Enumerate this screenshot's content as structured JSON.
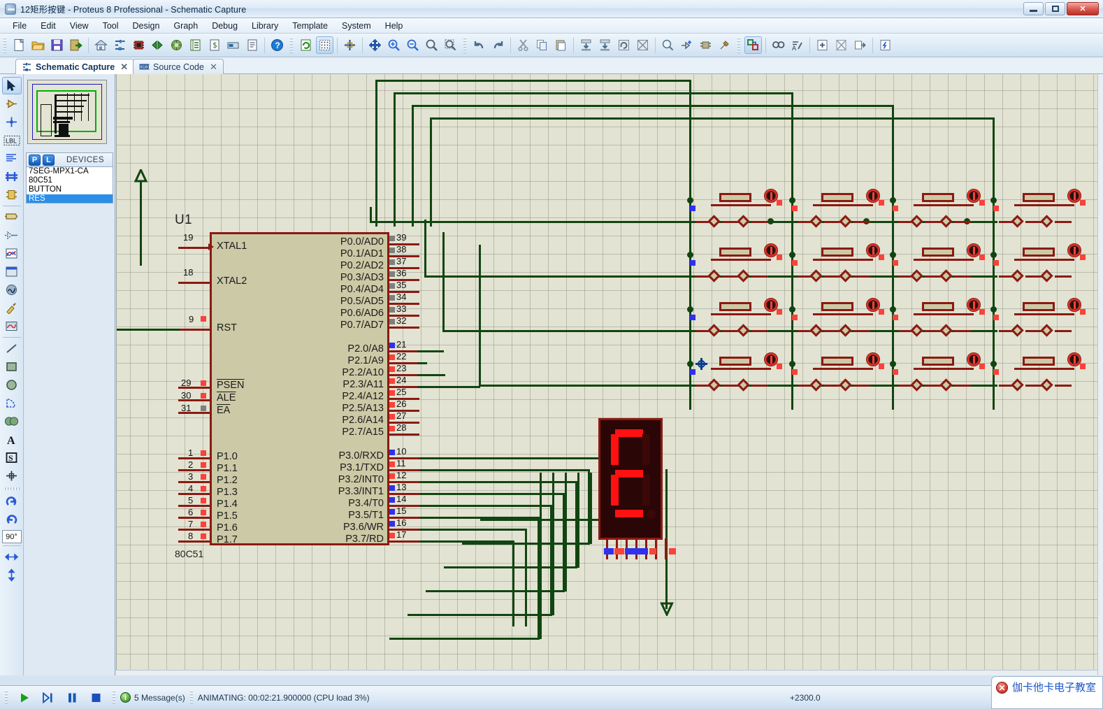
{
  "window": {
    "title": "12矩形按键 - Proteus 8 Professional - Schematic Capture",
    "app_icon": "proteus-app-icon",
    "minimize": "–",
    "maximize": "□",
    "close": "✕"
  },
  "menu": {
    "items": [
      "File",
      "Edit",
      "View",
      "Tool",
      "Design",
      "Graph",
      "Debug",
      "Library",
      "Template",
      "System",
      "Help"
    ]
  },
  "toolbar": {
    "groups": [
      {
        "name": "file-group",
        "buttons": [
          {
            "icon": "new-document-icon",
            "label": "New Project"
          },
          {
            "icon": "open-folder-icon",
            "label": "Open Project"
          },
          {
            "icon": "save-floppy-icon",
            "label": "Save Project"
          },
          {
            "icon": "import-export-icon",
            "label": "Import/Export"
          },
          {
            "icon": "home-icon",
            "label": "Home Page"
          },
          {
            "icon": "schematic-capture-icon",
            "label": "Schematic Capture"
          },
          {
            "icon": "pcb-layout-icon",
            "label": "PCB Layout"
          },
          {
            "icon": "3d-visualizer-icon",
            "label": "3D Visualizer"
          },
          {
            "icon": "simulation-icon",
            "label": "Simulation"
          },
          {
            "icon": "bill-of-materials-icon",
            "label": "Bill of Materials"
          },
          {
            "icon": "design-explorer-icon",
            "label": "Design Explorer"
          },
          {
            "icon": "report-icon",
            "label": "Reports"
          },
          {
            "icon": "notes-icon",
            "label": "Notes"
          },
          {
            "icon": "help-icon",
            "label": "Help"
          }
        ]
      },
      {
        "name": "view-group",
        "buttons": [
          {
            "icon": "refresh-icon",
            "label": "Redraw Display"
          },
          {
            "icon": "grid-toggle-icon",
            "label": "Toggle Grid",
            "active": true
          },
          {
            "icon": "origin-icon",
            "label": "Toggle Origin"
          },
          {
            "icon": "pan-icon",
            "label": "Pan"
          },
          {
            "icon": "zoom-in-icon",
            "label": "Zoom In"
          },
          {
            "icon": "zoom-out-icon",
            "label": "Zoom Out"
          },
          {
            "icon": "zoom-all-icon",
            "label": "Zoom To View Entire Sheet"
          },
          {
            "icon": "zoom-area-icon",
            "label": "Zoom To Area"
          }
        ]
      },
      {
        "name": "edit-group",
        "buttons": [
          {
            "icon": "undo-icon",
            "label": "Undo"
          },
          {
            "icon": "redo-icon",
            "label": "Redo"
          },
          {
            "icon": "cut-icon",
            "label": "Cut"
          },
          {
            "icon": "copy-icon",
            "label": "Copy"
          },
          {
            "icon": "paste-icon",
            "label": "Paste"
          },
          {
            "icon": "block-copy-icon",
            "label": "Block Copy"
          },
          {
            "icon": "block-move-icon",
            "label": "Block Move"
          },
          {
            "icon": "block-rotate-icon",
            "label": "Block Rotate"
          },
          {
            "icon": "block-delete-icon",
            "label": "Block Delete"
          },
          {
            "icon": "pick-device-icon",
            "label": "Pick Device"
          },
          {
            "icon": "make-device-icon",
            "label": "Make Device"
          },
          {
            "icon": "packaging-tool-icon",
            "label": "Packaging Tool"
          },
          {
            "icon": "decompose-icon",
            "label": "Decompose"
          }
        ]
      },
      {
        "name": "design-group",
        "buttons": [
          {
            "icon": "wire-autorouter-icon",
            "label": "Wire Auto Router",
            "active": true
          },
          {
            "icon": "search-tag-icon",
            "label": "Search and Tag"
          },
          {
            "icon": "property-assignment-icon",
            "label": "Property Assignment Tool"
          },
          {
            "icon": "new-sheet-icon",
            "label": "New Sheet"
          },
          {
            "icon": "remove-sheet-icon",
            "label": "Remove Sheet"
          },
          {
            "icon": "exit-sheet-icon",
            "label": "Exit Sheet"
          },
          {
            "icon": "design-report-icon",
            "label": "Design Explorer"
          }
        ]
      }
    ]
  },
  "tabs": [
    {
      "label": "Schematic Capture",
      "icon": "schematic-tab-icon",
      "selected": true,
      "close": "✕"
    },
    {
      "label": "Source Code",
      "icon": "source-code-tab-icon",
      "selected": false,
      "close": "✕"
    }
  ],
  "mode_toolbar": {
    "items": [
      {
        "icon": "selection-arrow-icon",
        "label": "Selection Mode",
        "active": true
      },
      {
        "icon": "component-mode-icon",
        "label": "Component Mode"
      },
      {
        "icon": "junction-dot-icon",
        "label": "Junction Dot Mode"
      },
      {
        "icon": "wire-label-icon",
        "label": "Wire Label Mode"
      },
      {
        "icon": "text-script-icon",
        "label": "Text Script Mode"
      },
      {
        "icon": "bus-mode-icon",
        "label": "Buses Mode"
      },
      {
        "icon": "subcircuit-icon",
        "label": "Subcircuit Mode"
      },
      {
        "icon": "terminals-icon",
        "label": "Terminals Mode"
      },
      {
        "icon": "device-pin-icon",
        "label": "Device Pins Mode"
      },
      {
        "icon": "graph-mode-icon",
        "label": "Graph Mode"
      },
      {
        "icon": "tape-recorder-icon",
        "label": "Tape Recorder Mode"
      },
      {
        "icon": "generator-icon",
        "label": "Generator Mode"
      },
      {
        "icon": "voltage-probe-icon",
        "label": "Voltage Probe Mode"
      },
      {
        "icon": "virtual-instrument-icon",
        "label": "Virtual Instruments Mode"
      },
      {
        "icon": "line-tool-icon",
        "label": "2D Graphics Line"
      },
      {
        "icon": "box-tool-icon",
        "label": "2D Graphics Box"
      },
      {
        "icon": "circle-tool-icon",
        "label": "2D Graphics Circle"
      },
      {
        "icon": "arc-tool-icon",
        "label": "2D Graphics Arc"
      },
      {
        "icon": "path-tool-icon",
        "label": "2D Graphics Closed Path"
      },
      {
        "icon": "text-tool-icon",
        "label": "2D Graphics Text"
      },
      {
        "icon": "symbol-tool-icon",
        "label": "2D Graphics Symbol"
      },
      {
        "icon": "marker-tool-icon",
        "label": "2D Graphics Markers"
      },
      {
        "icon": "rotate-cw-icon",
        "label": "Rotate Clockwise"
      },
      {
        "icon": "rotate-ccw-icon",
        "label": "Rotate Anti-Clockwise"
      },
      {
        "icon": "mirror-horizontal-icon",
        "label": "Mirror Horizontally"
      },
      {
        "icon": "mirror-vertical-icon",
        "label": "Mirror Vertically"
      }
    ],
    "rotation_value": "90°"
  },
  "left_panel": {
    "overview_title": "overview-preview",
    "devices_header": {
      "p_button": "P",
      "l_button": "L",
      "title": "DEVICES"
    },
    "devices": [
      {
        "name": "7SEG-MPX1-CA",
        "selected": false
      },
      {
        "name": "80C51",
        "selected": false
      },
      {
        "name": "BUTTON",
        "selected": false
      },
      {
        "name": "RES",
        "selected": true
      }
    ]
  },
  "schematic": {
    "ic": {
      "reference": "U1",
      "value": "80C51",
      "left_pins": [
        {
          "num": "19",
          "label": "XTAL1",
          "marker": "none"
        },
        {
          "num": "18",
          "label": "XTAL2",
          "marker": "none"
        },
        {
          "num": "9",
          "label": "RST",
          "marker": "red"
        },
        {
          "num": "29",
          "label": "PSEN",
          "overline": true,
          "marker": "red"
        },
        {
          "num": "30",
          "label": "ALE",
          "overline": true,
          "marker": "red"
        },
        {
          "num": "31",
          "label": "EA",
          "overline": true,
          "marker": "gray"
        },
        {
          "num": "1",
          "label": "P1.0",
          "marker": "red"
        },
        {
          "num": "2",
          "label": "P1.1",
          "marker": "red"
        },
        {
          "num": "3",
          "label": "P1.2",
          "marker": "red"
        },
        {
          "num": "4",
          "label": "P1.3",
          "marker": "red"
        },
        {
          "num": "5",
          "label": "P1.4",
          "marker": "red"
        },
        {
          "num": "6",
          "label": "P1.5",
          "marker": "red"
        },
        {
          "num": "7",
          "label": "P1.6",
          "marker": "red"
        },
        {
          "num": "8",
          "label": "P1.7",
          "marker": "red"
        }
      ],
      "right_pins": [
        {
          "num": "39",
          "label": "P0.0/AD0",
          "marker": "gray"
        },
        {
          "num": "38",
          "label": "P0.1/AD1",
          "marker": "gray"
        },
        {
          "num": "37",
          "label": "P0.2/AD2",
          "marker": "gray"
        },
        {
          "num": "36",
          "label": "P0.3/AD3",
          "marker": "gray"
        },
        {
          "num": "35",
          "label": "P0.4/AD4",
          "marker": "gray"
        },
        {
          "num": "34",
          "label": "P0.5/AD5",
          "marker": "gray"
        },
        {
          "num": "33",
          "label": "P0.6/AD6",
          "marker": "gray"
        },
        {
          "num": "32",
          "label": "P0.7/AD7",
          "marker": "gray"
        },
        {
          "num": "21",
          "label": "P2.0/A8",
          "marker": "blue"
        },
        {
          "num": "22",
          "label": "P2.1/A9",
          "marker": "red"
        },
        {
          "num": "23",
          "label": "P2.2/A10",
          "marker": "red"
        },
        {
          "num": "24",
          "label": "P2.3/A11",
          "marker": "red"
        },
        {
          "num": "25",
          "label": "P2.4/A12",
          "marker": "red"
        },
        {
          "num": "26",
          "label": "P2.5/A13",
          "marker": "red"
        },
        {
          "num": "27",
          "label": "P2.6/A14",
          "marker": "red"
        },
        {
          "num": "28",
          "label": "P2.7/A15",
          "marker": "red"
        },
        {
          "num": "10",
          "label": "P3.0/RXD",
          "marker": "blue"
        },
        {
          "num": "11",
          "label": "P3.1/TXD",
          "overline_part": "TXD",
          "marker": "red"
        },
        {
          "num": "12",
          "label": "P3.2/INT0",
          "overline_part": "INT0",
          "marker": "red"
        },
        {
          "num": "13",
          "label": "P3.3/INT1",
          "overline_part": "INT1",
          "marker": "blue"
        },
        {
          "num": "14",
          "label": "P3.4/T0",
          "marker": "blue"
        },
        {
          "num": "15",
          "label": "P3.5/T1",
          "overline_part": "T1",
          "marker": "blue"
        },
        {
          "num": "16",
          "label": "P3.6/WR",
          "overline_part": "WR",
          "marker": "blue"
        },
        {
          "num": "17",
          "label": "P3.7/RD",
          "overline_part": "RD",
          "marker": "red"
        }
      ]
    },
    "display": {
      "type": "7SEG-MPX1-CA",
      "shown_character": "E",
      "segments_on": [
        "a",
        "f",
        "g",
        "e",
        "d"
      ],
      "segments_off": [
        "b",
        "c",
        "dp"
      ]
    },
    "button_matrix": {
      "rows": 4,
      "cols": 4,
      "cell_component_resistor": "RES",
      "cell_component_button": "BUTTON"
    },
    "wire_color": "#114511",
    "component_color": "#8b1a12",
    "body_fill": "#ccc9a6"
  },
  "statusbar": {
    "play_label": "Run the simulation",
    "step_label": "Advance the simulation by one time step",
    "pause_label": "Pause the simulation",
    "stop_label": "Stop the simulation",
    "messages": "5 Message(s)",
    "messages_badge": "i",
    "animating": "ANIMATING: 00:02:21.900000 (CPU load 3%)",
    "coordinate": "+2300.0"
  },
  "watermark": {
    "close_glyph": "✕",
    "text": "伽卡他卡电子教室"
  }
}
